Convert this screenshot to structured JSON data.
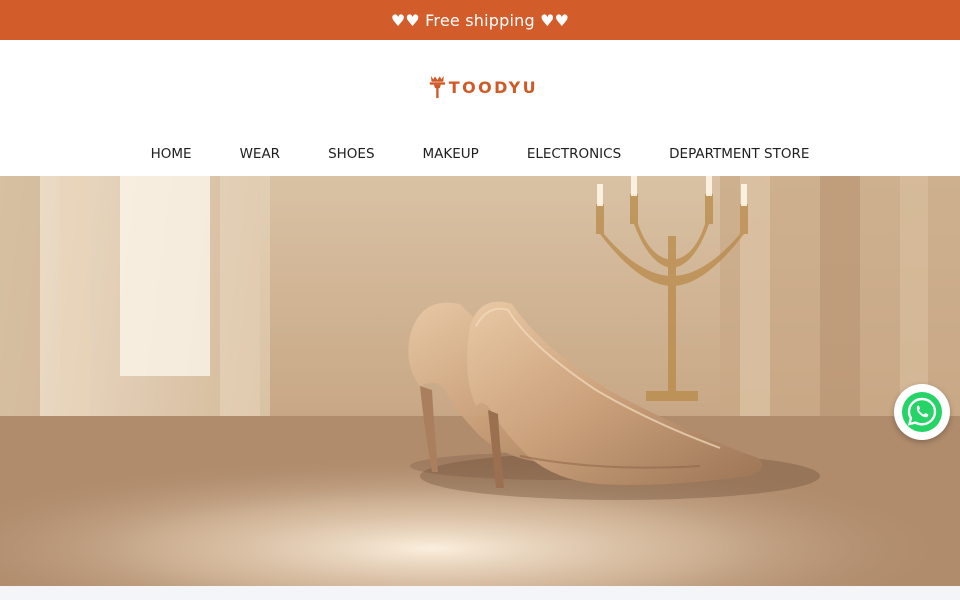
{
  "announcement": {
    "text": "♥♥ Free shipping ♥♥"
  },
  "brand": {
    "name": "TOODYU",
    "accent_color": "#d35c2b"
  },
  "nav": {
    "items": [
      {
        "label": "HOME"
      },
      {
        "label": "WEAR"
      },
      {
        "label": "SHOES"
      },
      {
        "label": "MAKEUP"
      },
      {
        "label": "ELECTRONICS"
      },
      {
        "label": "DEPARTMENT STORE"
      }
    ]
  },
  "hero": {
    "image_icon": "high-heel-shoes-image"
  },
  "chat": {
    "icon": "whatsapp-icon",
    "color": "#25d366"
  }
}
